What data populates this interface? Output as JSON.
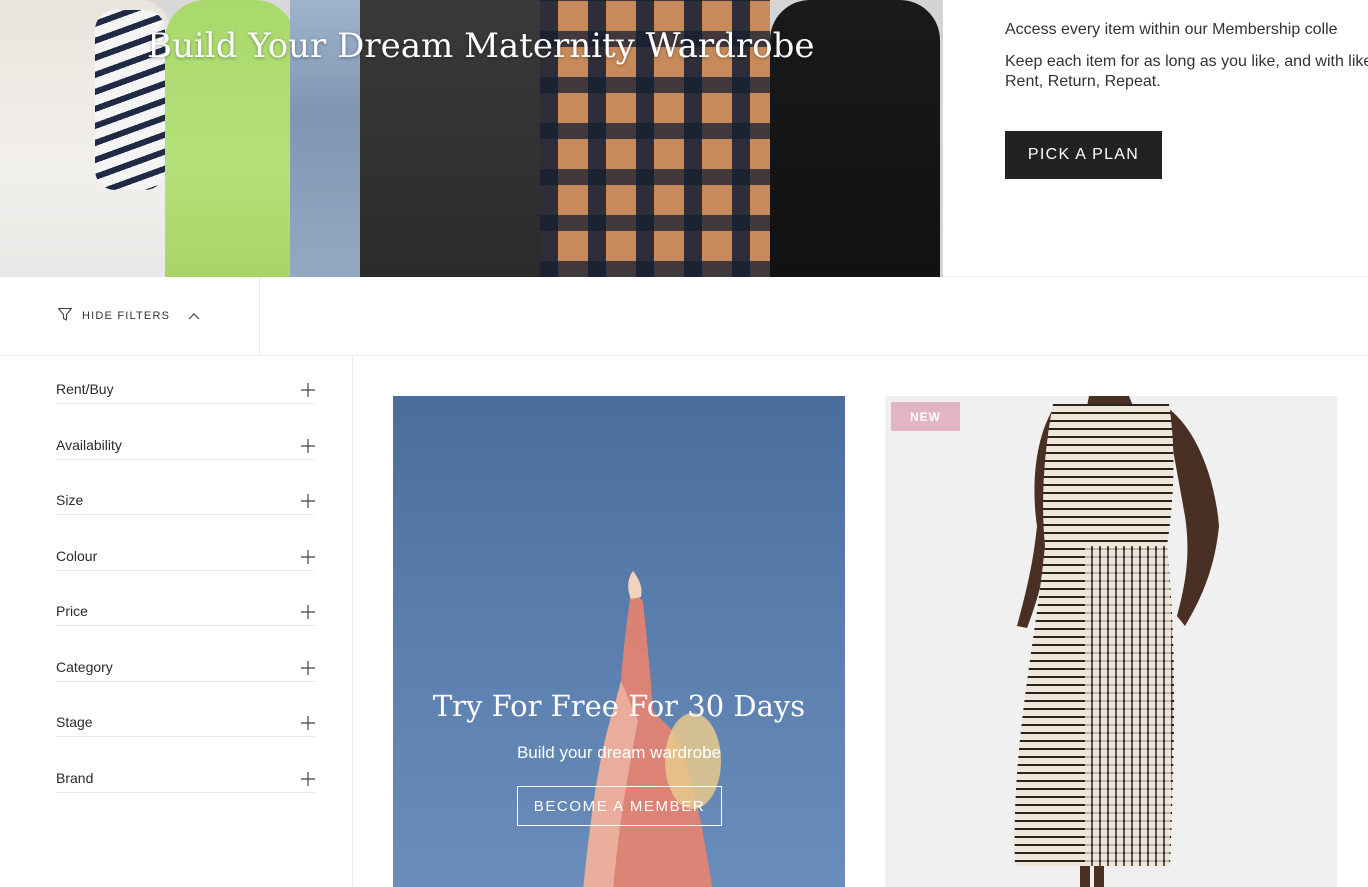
{
  "hero": {
    "title": "Build Your Dream Maternity Wardrobe",
    "copy_line1": "Access every item within our Membership colle",
    "copy_line2": "Keep each item for as long as you like, and with like. Rent, Return, Repeat.",
    "cta_label": "PICK A PLAN"
  },
  "filters": {
    "toggle_label": "HIDE FILTERS",
    "facets": [
      {
        "label": "Rent/Buy"
      },
      {
        "label": "Availability"
      },
      {
        "label": "Size"
      },
      {
        "label": "Colour"
      },
      {
        "label": "Price"
      },
      {
        "label": "Category"
      },
      {
        "label": "Stage"
      },
      {
        "label": "Brand"
      }
    ]
  },
  "promo": {
    "title": "Try For Free For 30 Days",
    "subtitle": "Build your dream wardrobe",
    "button_label": "BECOME A MEMBER"
  },
  "product": {
    "badge": "NEW"
  },
  "icons": {
    "filter": "funnel-icon",
    "collapse": "chevron-up-icon",
    "expand": "plus-icon"
  },
  "colors": {
    "button_dark": "#222222",
    "badge_pink": "#e2b4c6",
    "promo_sky": "#5b7fae"
  }
}
